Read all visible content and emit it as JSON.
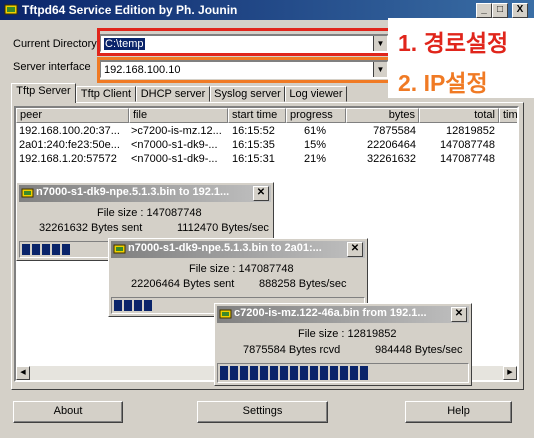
{
  "window": {
    "title": "Tftpd64 Service Edition by Ph. Jounin",
    "icon": "tftpd-app-icon",
    "controls": {
      "minimize": "_",
      "maximize": "□",
      "close": "X"
    }
  },
  "current_directory": {
    "label": "Current Directory",
    "value": "C:\\temp"
  },
  "server_interface": {
    "label": "Server interface",
    "value": "192.168.100.10"
  },
  "annotations": {
    "path": "1. 경로설정",
    "ip": "2. IP설정",
    "colors": {
      "red": "#e0251b",
      "orange": "#f07a24"
    }
  },
  "tabs": [
    {
      "label": "Tftp Server",
      "active": true
    },
    {
      "label": "Tftp Client",
      "active": false
    },
    {
      "label": "DHCP server",
      "active": false
    },
    {
      "label": "Syslog server",
      "active": false
    },
    {
      "label": "Log viewer",
      "active": false
    }
  ],
  "table": {
    "columns": [
      "peer",
      "file",
      "start time",
      "progress",
      "bytes",
      "total",
      "tim"
    ],
    "rows": [
      {
        "peer": "192.168.100.20:37...",
        "file": ">c7200-is-mz.12...",
        "start_time": "16:15:52",
        "progress": "61%",
        "bytes": "7875584",
        "total": "12819852"
      },
      {
        "peer": "2a01:240:fe23:50e...",
        "file": "<n7000-s1-dk9-...",
        "start_time": "16:15:35",
        "progress": "15%",
        "bytes": "22206464",
        "total": "147087748"
      },
      {
        "peer": "192.168.1.20:57572",
        "file": "<n7000-s1-dk9-...",
        "start_time": "16:15:31",
        "progress": "21%",
        "bytes": "32261632",
        "total": "147087748"
      }
    ]
  },
  "transfers": [
    {
      "title": "n7000-s1-dk9-npe.5.1.3.bin to 192.1...",
      "file_size": "File size : 147087748",
      "bytes_text": "32261632 Bytes sent",
      "rate": "1112470 Bytes/sec",
      "progress": 0.22
    },
    {
      "title": "n7000-s1-dk9-npe.5.1.3.bin to 2a01:...",
      "file_size": "File size : 147087748",
      "bytes_text": "22206464 Bytes sent",
      "rate": "888258 Bytes/sec",
      "progress": 0.15
    },
    {
      "title": "c7200-is-mz.122-46a.bin from 192.1...",
      "file_size": "File size : 12819852",
      "bytes_text": "7875584 Bytes rcvd",
      "rate": "984448 Bytes/sec",
      "progress": 0.61
    }
  ],
  "buttons": {
    "about": "About",
    "settings": "Settings",
    "help": "Help"
  }
}
